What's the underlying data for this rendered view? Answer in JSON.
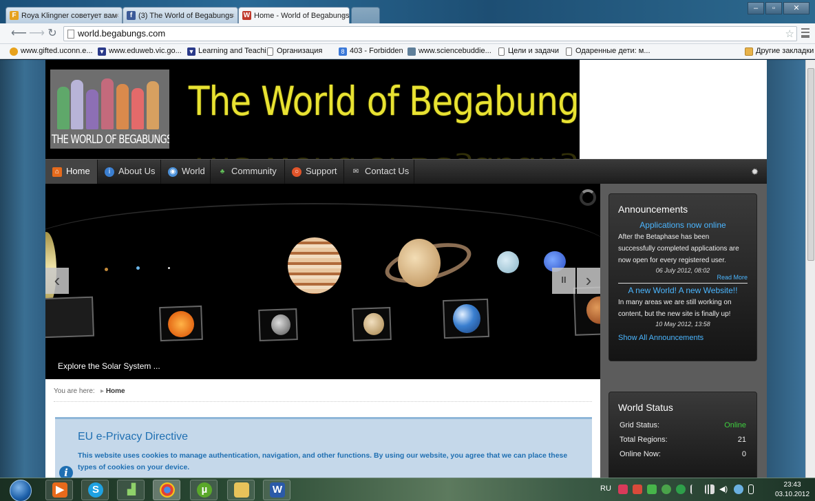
{
  "browser": {
    "tabs": [
      {
        "label": "Roya Klingner советует вам",
        "favicon": "F"
      },
      {
        "label": "(3) The World of Begabungs",
        "favicon": "f"
      },
      {
        "label": "Home - World of Begabungs",
        "favicon": "W"
      }
    ],
    "url": "world.begabungs.com",
    "bookmarks": [
      "www.gifted.uconn.e...",
      "www.eduweb.vic.go...",
      "Learning and Teachi...",
      "Организация",
      "403 - Forbidden",
      "www.sciencebuddie...",
      "Цели и задачи",
      "Одаренные дети: м..."
    ],
    "other_bookmarks": "Другие закладки"
  },
  "site": {
    "logo_caption": "THE WORLD OF BEGABUNGS",
    "title": "The World of Begabungs",
    "nav": [
      {
        "label": "Home",
        "icon": "home-icon"
      },
      {
        "label": "About Us",
        "icon": "info-icon"
      },
      {
        "label": "World",
        "icon": "globe-icon"
      },
      {
        "label": "Community",
        "icon": "community-icon"
      },
      {
        "label": "Support",
        "icon": "lifebuoy-icon"
      },
      {
        "label": "Contact Us",
        "icon": "mail-icon"
      }
    ],
    "slide_caption": "Explore the Solar System ...",
    "slider_prev": "‹",
    "slider_next": "›",
    "slider_pause": "II",
    "breadcrumb_label": "You are here:",
    "breadcrumb_current": "Home",
    "notice_title": "EU e-Privacy Directive",
    "notice_text": "This website uses cookies to manage authentication, navigation, and other functions. By using our website, you agree that we can place these types of cookies on your device."
  },
  "announcements": {
    "heading": "Announcements",
    "items": [
      {
        "title": "Applications now online",
        "body": "After the Betaphase has been successfully completed applications are now open for every registered user.",
        "date": "06 July 2012, 08:02",
        "more": "Read More"
      },
      {
        "title": "A new World! A new Website!!",
        "body": "In many areas we are still working on content, but the new site is finally up!",
        "date": "10 May 2012, 13:58"
      }
    ],
    "show_all": "Show All Announcements"
  },
  "world_status": {
    "heading": "World Status",
    "rows": [
      {
        "label": "Grid Status:",
        "value": "Online",
        "color": "#3fd13f"
      },
      {
        "label": "Total Regions:",
        "value": "21"
      },
      {
        "label": "Online Now:",
        "value": "0"
      }
    ]
  },
  "taskbar": {
    "language": "RU",
    "time": "23:43",
    "date": "03.10.2012"
  }
}
